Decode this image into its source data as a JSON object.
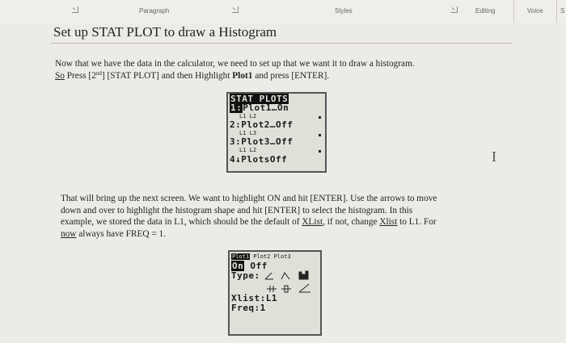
{
  "ribbon": {
    "paragraph_label": "Paragraph",
    "styles_label": "Styles",
    "editing_label": "Editing",
    "voice_label": "Voice",
    "edge_label": "S"
  },
  "document": {
    "heading": "Set up STAT PLOT to draw a Histogram",
    "para1": {
      "line1": "Now that we have the data in the calculator, we need to set up that we want it to draw a histogram.",
      "so": "So",
      "l2a": " Press [2",
      "sup": "nd",
      "l2b": "] [STAT PLOT] and then Highlight ",
      "plot1": "Plot1",
      "l2c": " and press [ENTER]."
    },
    "para2": {
      "line1": "That will bring up the next screen. We want to highlight ON and hit [ENTER]. Use the arrows to move",
      "line2": "down and over to highlight the histogram shape and hit [ENTER] to select the histogram. In this",
      "line3a": "example, we stored the data in L1, which should be the default of ",
      "xlist1": "XList",
      "line3b": ", if not, change ",
      "xlist2": "Xlist",
      "line3c": " to L1. For",
      "now": "now",
      "line4": " always have FREQ = 1."
    }
  },
  "calc1": {
    "title": "STAT PLOTS",
    "sel": "1:",
    "item1": "Plot1…On",
    "item1_sub": "L1    L2",
    "item2": "2:Plot2…Off",
    "item2_sub": "L1    L3",
    "item3": "3:Plot3…Off",
    "item3_sub": "L1    L2",
    "item4": "4↓PlotsOff"
  },
  "calc2": {
    "tab1": "Plot1",
    "tab2": "Plot2",
    "tab3": "Plot3",
    "on": "On",
    "off": "Off",
    "type": "Type:",
    "xlist": "Xlist:L1",
    "freq": "Freq:1"
  },
  "text_cursor": "I"
}
